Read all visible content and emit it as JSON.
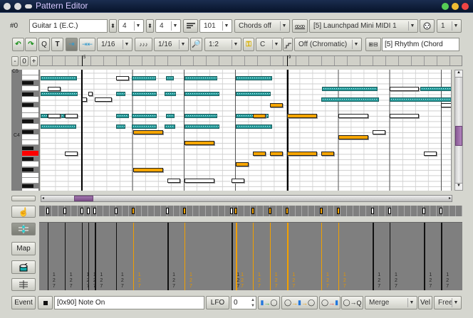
{
  "window": {
    "title": "Pattern Editor"
  },
  "toolbar1": {
    "pattern_index": "#0",
    "track_name": "Guitar 1 (E.C.)",
    "beats_per_bar": "4",
    "beat_unit": "4",
    "velocity": "101",
    "chords": "Chords off",
    "midi_input": "[5] Launchpad Mini MIDI 1",
    "channel": "1"
  },
  "toolbar2": {
    "q_label": "Q",
    "snap": "1/16",
    "note_length": "1/16",
    "zoom": "1:2",
    "key": "C",
    "scale": "Off (Chromatic)",
    "chord_pattern": "[5] Rhythm (Chord"
  },
  "ruler": {
    "minus": "-",
    "zero": "0",
    "plus": "+",
    "bars": [
      {
        "label": "5",
        "beat": 0
      },
      {
        "label": "9",
        "beat": 4
      }
    ]
  },
  "keyboard": {
    "labels": [
      "C5",
      "C4"
    ]
  },
  "notes": [
    [
      71,
      -0.8,
      0.71,
      "t"
    ],
    [
      71,
      0.67,
      0.25,
      "w"
    ],
    [
      71,
      0.98,
      0.47,
      "t"
    ],
    [
      71,
      1.64,
      0.15,
      "t"
    ],
    [
      71,
      2.0,
      0.64,
      "t"
    ],
    [
      71,
      3.0,
      0.7,
      "t"
    ],
    [
      69,
      -0.66,
      0.25,
      "w"
    ],
    [
      69,
      4.67,
      1.08,
      "t"
    ],
    [
      69,
      5.99,
      0.57,
      "w"
    ],
    [
      69,
      6.58,
      0.7,
      "t"
    ],
    [
      68,
      -0.8,
      0.72,
      "t"
    ],
    [
      68,
      0.13,
      0.08,
      "w"
    ],
    [
      68,
      0.67,
      0.18,
      "t"
    ],
    [
      68,
      0.98,
      0.48,
      "t"
    ],
    [
      68,
      1.61,
      0.23,
      "t"
    ],
    [
      68,
      2.0,
      0.68,
      "t"
    ],
    [
      68,
      3.0,
      0.68,
      "t"
    ],
    [
      67,
      0,
      0.1,
      "w"
    ],
    [
      67,
      0.26,
      0.33,
      "w"
    ],
    [
      67,
      4.66,
      1.12,
      "t"
    ],
    [
      67,
      5.99,
      1.3,
      "t"
    ],
    [
      66,
      3.66,
      0.25,
      "o"
    ],
    [
      66,
      6.99,
      0.3,
      "w"
    ],
    [
      64,
      -0.8,
      0.14,
      "t"
    ],
    [
      64,
      -0.66,
      0.25,
      "w"
    ],
    [
      64,
      -0.41,
      0.08,
      "t"
    ],
    [
      64,
      -0.33,
      0.25,
      "w"
    ],
    [
      64,
      0.67,
      0.25,
      "t"
    ],
    [
      64,
      0.98,
      0.48,
      "t"
    ],
    [
      64,
      1.64,
      0.17,
      "t"
    ],
    [
      64,
      2.0,
      0.64,
      "t"
    ],
    [
      64,
      3.0,
      0.64,
      "t"
    ],
    [
      64,
      3.33,
      0.25,
      "o"
    ],
    [
      64,
      4.0,
      0.58,
      "o"
    ],
    [
      64,
      4.99,
      0.58,
      "w"
    ],
    [
      64,
      5.99,
      0.57,
      "w"
    ],
    [
      62,
      -0.8,
      0.69,
      "t"
    ],
    [
      62,
      0.67,
      0.18,
      "t"
    ],
    [
      62,
      0.98,
      0.48,
      "t"
    ],
    [
      62,
      1.61,
      0.21,
      "t"
    ],
    [
      62,
      2.0,
      0.68,
      "t"
    ],
    [
      62,
      3.0,
      0.7,
      "t"
    ],
    [
      61,
      1.0,
      0.59,
      "o"
    ],
    [
      61,
      5.66,
      0.25,
      "w"
    ],
    [
      60,
      4.99,
      0.58,
      "o"
    ],
    [
      59,
      2.0,
      0.58,
      "o"
    ],
    [
      57,
      -0.33,
      0.25,
      "w"
    ],
    [
      57,
      3.33,
      0.25,
      "o"
    ],
    [
      57,
      3.66,
      0.25,
      "o"
    ],
    [
      57,
      4.0,
      0.58,
      "o"
    ],
    [
      57,
      4.66,
      0.25,
      "o"
    ],
    [
      57,
      6.66,
      0.24,
      "w"
    ],
    [
      55,
      3.0,
      0.25,
      "o"
    ],
    [
      54,
      1.0,
      0.59,
      "o"
    ],
    [
      52,
      1.67,
      0.25,
      "w"
    ],
    [
      52,
      2.0,
      0.58,
      "w"
    ],
    [
      52,
      2.92,
      0.25,
      "w"
    ]
  ],
  "velocity_value": "127",
  "side": {
    "map_label": "Map"
  },
  "bottom": {
    "event_label": "Event",
    "event_type": "[0x90] Note On",
    "lfo_label": "LFO",
    "lfo_value": "0",
    "q_label": "Q",
    "merge": "Merge",
    "vel_label": "Vel",
    "free": "Free"
  },
  "colors": {
    "selected_note": "#f6a500",
    "other_track_note": "#2a9a9a",
    "titlebar": "#0b1a33"
  }
}
